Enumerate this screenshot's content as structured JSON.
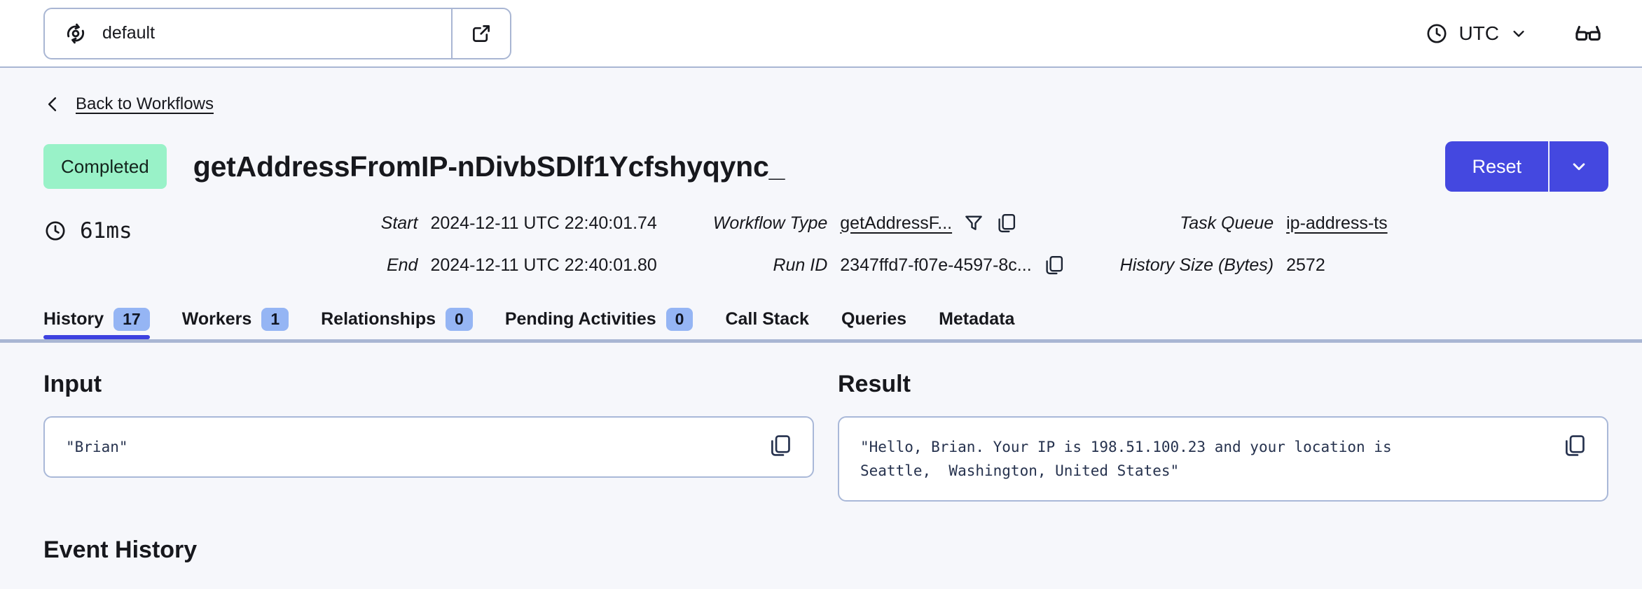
{
  "topbar": {
    "namespace": "default",
    "timezone": "UTC",
    "icons": [
      "namespace-switcher-icon",
      "external-link-icon",
      "clock-icon",
      "chevron-down-icon",
      "glasses-icon"
    ]
  },
  "back_link_label": "Back to Workflows",
  "workflow": {
    "status": "Completed",
    "title": "getAddressFromIP-nDivbSDlf1Ycfshyqync_",
    "duration": "61ms",
    "reset_label": "Reset",
    "details": [
      {
        "label": "Start",
        "value": "2024-12-11 UTC 22:40:01.74"
      },
      {
        "label": "End",
        "value": "2024-12-11 UTC 22:40:01.80"
      },
      {
        "label": "Workflow Type",
        "value": "getAddressF..."
      },
      {
        "label": "Run ID",
        "value": "2347ffd7-f07e-4597-8c..."
      },
      {
        "label": "Task Queue",
        "value": "ip-address-ts"
      },
      {
        "label": "History Size (Bytes)",
        "value": "2572"
      }
    ]
  },
  "tabs": [
    {
      "label": "History",
      "count": "17",
      "active": true
    },
    {
      "label": "Workers",
      "count": "1",
      "active": false
    },
    {
      "label": "Relationships",
      "count": "0",
      "active": false
    },
    {
      "label": "Pending Activities",
      "count": "0",
      "active": false
    },
    {
      "label": "Call Stack",
      "active": false
    },
    {
      "label": "Queries",
      "active": false
    },
    {
      "label": "Metadata",
      "active": false
    }
  ],
  "panels": {
    "input": {
      "heading": "Input",
      "content": "\"Brian\""
    },
    "result": {
      "heading": "Result",
      "content": "\"Hello, Brian. Your IP is 198.51.100.23 and your location is\nSeattle,  Washington, United States\""
    }
  },
  "sections": {
    "event_history": "Event History"
  },
  "colors": {
    "accent": "#4448e0",
    "active_tab_underline": "#3d41df",
    "status_completed_bg": "#99f2c8",
    "tab_count_bg": "#95b5f4",
    "border": "#a9b6d3",
    "page_bg": "#f6f7fb",
    "code_text": "#26324e"
  }
}
